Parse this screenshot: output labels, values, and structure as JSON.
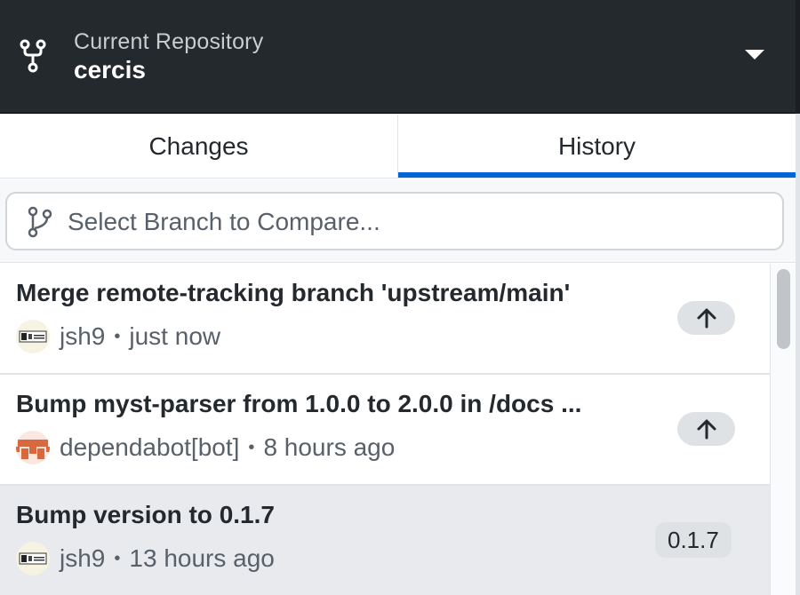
{
  "header": {
    "label": "Current Repository",
    "repo_name": "cercis",
    "icon": "repo-fork-icon",
    "caret_icon": "caret-down-icon",
    "bg_color": "#24292e"
  },
  "tabs": [
    {
      "label": "Changes",
      "active": false
    },
    {
      "label": "History",
      "active": true
    }
  ],
  "accent_color": "#0366d6",
  "compare": {
    "placeholder": "Select Branch to Compare...",
    "icon": "git-branch-icon"
  },
  "commits": [
    {
      "title": "Merge remote-tracking branch 'upstream/main'",
      "author": "jsh9",
      "time": "just now",
      "badge": "arrow-up-icon",
      "selected": false
    },
    {
      "title": "Bump myst-parser from 1.0.0 to 2.0.0 in /docs ...",
      "author": "dependabot[bot]",
      "time": "8 hours ago",
      "badge": "arrow-up-icon",
      "selected": false
    },
    {
      "title": "Bump version to 0.1.7",
      "author": "jsh9",
      "time": "13 hours ago",
      "tag": "0.1.7",
      "selected": true
    }
  ],
  "separator": "•"
}
